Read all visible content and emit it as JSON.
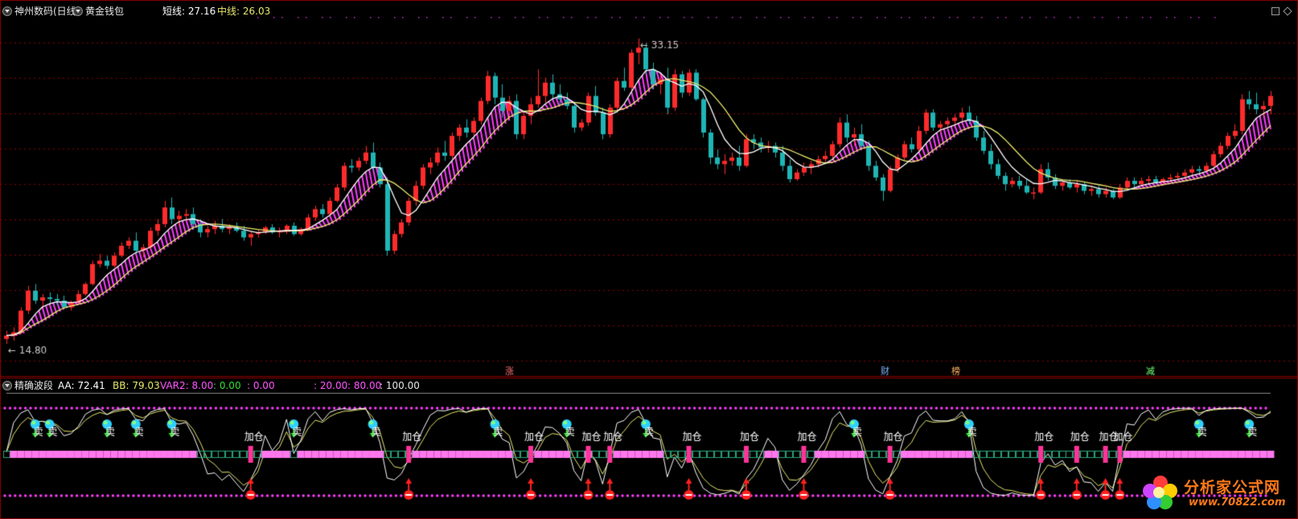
{
  "header": {
    "stock_name": "神州数码(日线)",
    "indicator_name": "黄金钱包",
    "short_label": "短线:",
    "short_value": "27.16",
    "mid_label": "中线:",
    "mid_value": "26.03"
  },
  "sub_header": {
    "indicator_name": "精确波段",
    "aa_label": "AA:",
    "aa_value": "72.41",
    "bb_label": "BB:",
    "bb_value": "79.03",
    "var2_label": "VAR2:",
    "var2_values": [
      "8.00",
      "0.00",
      "0.00",
      "20.00",
      "80.00",
      "100.00"
    ]
  },
  "logo": {
    "title": "分析家公式网",
    "url": "www.70822.com"
  },
  "colors": {
    "up": "#ff2b2b",
    "down": "#1fb5b5",
    "short_line": "#ffffff",
    "mid_line": "#e8e86a",
    "fill": "#ff3cff",
    "grid": "#8b0000",
    "dotted": "#ff3cff"
  },
  "chart_data": [
    {
      "type": "candlestick",
      "title": "黄金钱包",
      "price_range": [
        13.5,
        34.5
      ],
      "max_label": "33.15",
      "min_label": "14.80",
      "ohlc": [
        [
          15.1,
          15.6,
          14.8,
          15.3
        ],
        [
          15.3,
          15.8,
          15.0,
          15.5
        ],
        [
          15.5,
          17.0,
          15.4,
          16.8
        ],
        [
          16.8,
          18.3,
          16.6,
          18.0
        ],
        [
          18.0,
          18.4,
          17.2,
          17.4
        ],
        [
          17.4,
          17.8,
          17.0,
          17.6
        ],
        [
          17.6,
          17.9,
          17.2,
          17.5
        ],
        [
          17.5,
          17.8,
          17.1,
          17.4
        ],
        [
          17.4,
          17.7,
          16.9,
          17.0
        ],
        [
          17.0,
          17.4,
          16.8,
          17.3
        ],
        [
          17.3,
          18.0,
          17.2,
          17.8
        ],
        [
          17.8,
          18.5,
          17.7,
          18.4
        ],
        [
          18.4,
          19.8,
          18.3,
          19.6
        ],
        [
          19.6,
          20.2,
          19.4,
          19.8
        ],
        [
          19.8,
          20.1,
          19.3,
          19.5
        ],
        [
          19.5,
          20.3,
          19.4,
          20.1
        ],
        [
          20.1,
          20.9,
          20.0,
          20.7
        ],
        [
          20.7,
          21.2,
          20.5,
          21.0
        ],
        [
          21.0,
          21.5,
          20.2,
          20.4
        ],
        [
          20.4,
          20.8,
          20.0,
          20.6
        ],
        [
          20.6,
          21.8,
          20.5,
          21.6
        ],
        [
          21.6,
          22.3,
          21.3,
          22.0
        ],
        [
          22.0,
          23.4,
          21.8,
          23.0
        ],
        [
          23.0,
          23.6,
          22.0,
          22.3
        ],
        [
          22.3,
          22.8,
          21.9,
          22.5
        ],
        [
          22.5,
          22.9,
          22.2,
          22.6
        ],
        [
          22.6,
          23.0,
          21.7,
          22.0
        ],
        [
          22.0,
          22.3,
          21.2,
          21.5
        ],
        [
          21.5,
          21.9,
          21.2,
          21.7
        ],
        [
          21.7,
          22.2,
          21.4,
          21.9
        ],
        [
          21.9,
          22.3,
          21.5,
          21.7
        ],
        [
          21.7,
          22.0,
          21.4,
          21.8
        ],
        [
          21.8,
          22.1,
          21.5,
          21.6
        ],
        [
          21.6,
          21.9,
          21.0,
          21.2
        ],
        [
          21.2,
          21.6,
          20.7,
          21.4
        ],
        [
          21.4,
          21.7,
          21.2,
          21.5
        ],
        [
          21.5,
          21.9,
          21.4,
          21.8
        ],
        [
          21.8,
          22.0,
          21.4,
          21.5
        ],
        [
          21.5,
          21.8,
          21.2,
          21.6
        ],
        [
          21.6,
          22.0,
          21.4,
          21.9
        ],
        [
          21.9,
          22.1,
          21.3,
          21.4
        ],
        [
          21.4,
          21.8,
          21.3,
          21.7
        ],
        [
          21.7,
          22.6,
          21.6,
          22.4
        ],
        [
          22.4,
          23.1,
          22.2,
          22.9
        ],
        [
          22.9,
          23.2,
          22.4,
          22.6
        ],
        [
          22.6,
          23.6,
          22.5,
          23.4
        ],
        [
          23.4,
          24.4,
          23.3,
          24.2
        ],
        [
          24.2,
          25.7,
          24.0,
          25.5
        ],
        [
          25.5,
          25.9,
          25.1,
          25.4
        ],
        [
          25.4,
          26.0,
          25.2,
          25.8
        ],
        [
          25.8,
          26.7,
          25.6,
          26.3
        ],
        [
          26.3,
          26.9,
          25.2,
          25.4
        ],
        [
          25.4,
          25.7,
          24.2,
          24.4
        ],
        [
          24.4,
          24.8,
          20.1,
          20.4
        ],
        [
          20.4,
          21.6,
          20.2,
          21.4
        ],
        [
          21.4,
          22.3,
          21.2,
          22.1
        ],
        [
          22.1,
          23.6,
          21.9,
          23.4
        ],
        [
          23.4,
          24.6,
          23.1,
          24.3
        ],
        [
          24.3,
          25.6,
          24.1,
          25.4
        ],
        [
          25.4,
          26.0,
          25.0,
          25.7
        ],
        [
          25.7,
          26.6,
          25.5,
          26.3
        ],
        [
          26.3,
          27.0,
          25.8,
          26.1
        ],
        [
          26.1,
          27.5,
          25.9,
          27.3
        ],
        [
          27.3,
          28.0,
          27.0,
          27.8
        ],
        [
          27.8,
          28.3,
          27.2,
          27.5
        ],
        [
          27.5,
          28.4,
          27.3,
          28.2
        ],
        [
          28.2,
          29.6,
          28.0,
          29.4
        ],
        [
          29.4,
          31.2,
          29.2,
          30.9
        ],
        [
          30.9,
          31.1,
          29.2,
          29.6
        ],
        [
          29.6,
          30.4,
          28.4,
          28.8
        ],
        [
          28.8,
          29.7,
          28.3,
          29.4
        ],
        [
          29.4,
          29.8,
          27.1,
          27.4
        ],
        [
          27.4,
          28.8,
          27.1,
          28.5
        ],
        [
          28.5,
          29.6,
          28.0,
          29.2
        ],
        [
          29.2,
          31.3,
          29.0,
          29.7
        ],
        [
          29.7,
          30.8,
          29.3,
          30.5
        ],
        [
          30.5,
          31.0,
          29.5,
          29.8
        ],
        [
          29.8,
          30.4,
          29.2,
          29.5
        ],
        [
          29.5,
          29.9,
          28.9,
          29.1
        ],
        [
          29.1,
          29.3,
          27.5,
          27.8
        ],
        [
          27.8,
          28.3,
          27.6,
          28.1
        ],
        [
          28.1,
          29.9,
          27.9,
          29.7
        ],
        [
          29.7,
          30.3,
          28.5,
          28.7
        ],
        [
          28.7,
          29.0,
          27.1,
          27.4
        ],
        [
          27.4,
          29.2,
          27.2,
          29.0
        ],
        [
          29.0,
          30.8,
          28.8,
          30.6
        ],
        [
          30.6,
          31.4,
          30.0,
          30.2
        ],
        [
          30.2,
          32.5,
          30.0,
          32.3
        ],
        [
          32.3,
          33.15,
          31.6,
          32.6
        ],
        [
          32.6,
          32.9,
          31.0,
          31.3
        ],
        [
          31.3,
          31.7,
          30.1,
          30.4
        ],
        [
          30.4,
          31.0,
          29.8,
          30.7
        ],
        [
          30.7,
          31.4,
          28.6,
          29.0
        ],
        [
          29.0,
          31.3,
          28.8,
          31.0
        ],
        [
          31.0,
          31.2,
          29.6,
          29.9
        ],
        [
          29.9,
          31.3,
          29.7,
          31.1
        ],
        [
          31.1,
          31.3,
          29.4,
          29.5
        ],
        [
          29.5,
          29.6,
          27.2,
          27.5
        ],
        [
          27.5,
          27.7,
          25.6,
          26.0
        ],
        [
          26.0,
          26.5,
          25.3,
          25.6
        ],
        [
          25.6,
          26.2,
          25.0,
          25.8
        ],
        [
          25.8,
          26.3,
          25.5,
          26.0
        ],
        [
          26.0,
          26.7,
          25.2,
          25.5
        ],
        [
          25.5,
          27.4,
          25.4,
          27.1
        ],
        [
          27.1,
          27.4,
          26.5,
          26.9
        ],
        [
          26.9,
          27.2,
          26.3,
          26.6
        ],
        [
          26.6,
          27.0,
          26.3,
          26.7
        ],
        [
          26.7,
          26.9,
          26.0,
          26.3
        ],
        [
          26.3,
          26.7,
          25.2,
          25.5
        ],
        [
          25.5,
          25.9,
          24.5,
          24.7
        ],
        [
          24.7,
          25.3,
          24.6,
          25.1
        ],
        [
          25.1,
          25.7,
          24.9,
          25.4
        ],
        [
          25.4,
          25.8,
          25.0,
          25.6
        ],
        [
          25.6,
          26.1,
          25.4,
          25.9
        ],
        [
          25.9,
          26.4,
          25.6,
          26.1
        ],
        [
          26.1,
          27.0,
          25.9,
          26.8
        ],
        [
          26.8,
          28.4,
          26.6,
          28.1
        ],
        [
          28.1,
          28.6,
          26.9,
          27.2
        ],
        [
          27.2,
          27.8,
          26.7,
          27.4
        ],
        [
          27.4,
          28.0,
          26.5,
          26.7
        ],
        [
          26.7,
          27.0,
          25.2,
          25.5
        ],
        [
          25.5,
          25.8,
          24.6,
          24.8
        ],
        [
          24.8,
          25.0,
          23.4,
          24.0
        ],
        [
          24.0,
          25.5,
          23.9,
          25.3
        ],
        [
          25.3,
          26.2,
          25.1,
          26.0
        ],
        [
          26.0,
          27.0,
          25.8,
          26.8
        ],
        [
          26.8,
          27.2,
          26.3,
          26.5
        ],
        [
          26.5,
          27.9,
          26.3,
          27.6
        ],
        [
          27.6,
          28.9,
          27.4,
          28.7
        ],
        [
          28.7,
          28.9,
          27.6,
          27.8
        ],
        [
          27.8,
          28.2,
          27.5,
          28.0
        ],
        [
          28.0,
          28.4,
          27.7,
          28.2
        ],
        [
          28.2,
          28.6,
          27.9,
          28.4
        ],
        [
          28.4,
          29.0,
          28.1,
          28.7
        ],
        [
          28.7,
          29.1,
          28.0,
          28.2
        ],
        [
          28.2,
          28.5,
          27.0,
          27.2
        ],
        [
          27.2,
          27.6,
          26.2,
          26.4
        ],
        [
          26.4,
          26.8,
          25.3,
          25.6
        ],
        [
          25.6,
          25.9,
          24.7,
          24.9
        ],
        [
          24.9,
          25.1,
          24.0,
          24.4
        ],
        [
          24.4,
          24.8,
          24.2,
          24.6
        ],
        [
          24.6,
          24.9,
          24.1,
          24.3
        ],
        [
          24.3,
          24.7,
          23.8,
          23.9
        ],
        [
          23.9,
          24.2,
          23.5,
          23.9
        ],
        [
          23.9,
          25.6,
          23.8,
          25.3
        ],
        [
          25.3,
          25.7,
          24.6,
          24.8
        ],
        [
          24.8,
          25.0,
          24.1,
          24.3
        ],
        [
          24.3,
          24.6,
          24.0,
          24.5
        ],
        [
          24.5,
          24.7,
          24.1,
          24.2
        ],
        [
          24.2,
          24.6,
          23.9,
          24.4
        ],
        [
          24.4,
          24.5,
          23.8,
          24.0
        ],
        [
          24.0,
          24.3,
          23.7,
          24.1
        ],
        [
          24.1,
          24.3,
          23.6,
          23.8
        ],
        [
          23.8,
          24.2,
          23.6,
          24.0
        ],
        [
          24.0,
          24.1,
          23.5,
          23.6
        ],
        [
          23.6,
          24.4,
          23.5,
          24.2
        ],
        [
          24.2,
          24.8,
          24.1,
          24.6
        ],
        [
          24.6,
          24.8,
          24.2,
          24.4
        ],
        [
          24.4,
          24.8,
          24.3,
          24.6
        ],
        [
          24.6,
          24.9,
          24.4,
          24.7
        ],
        [
          24.7,
          24.9,
          24.4,
          24.5
        ],
        [
          24.5,
          24.8,
          24.3,
          24.7
        ],
        [
          24.7,
          25.0,
          24.5,
          24.8
        ],
        [
          24.8,
          25.1,
          24.6,
          24.9
        ],
        [
          24.9,
          25.3,
          24.7,
          25.1
        ],
        [
          25.1,
          25.5,
          24.9,
          25.3
        ],
        [
          25.3,
          25.5,
          25.0,
          25.2
        ],
        [
          25.2,
          25.7,
          25.1,
          25.5
        ],
        [
          25.5,
          26.4,
          25.4,
          26.2
        ],
        [
          26.2,
          26.9,
          26.0,
          26.7
        ],
        [
          26.7,
          27.5,
          26.5,
          27.3
        ],
        [
          27.3,
          28.0,
          27.1,
          27.6
        ],
        [
          27.6,
          29.8,
          27.4,
          29.5
        ],
        [
          29.5,
          30.0,
          28.9,
          29.2
        ],
        [
          29.2,
          29.9,
          28.6,
          28.9
        ],
        [
          28.9,
          29.4,
          28.5,
          29.1
        ],
        [
          29.1,
          30.0,
          28.6,
          29.7
        ]
      ],
      "short_line_last": 27.16,
      "mid_line_last": 26.03,
      "event_markers": [
        "涨",
        "财",
        "榜",
        "减"
      ]
    },
    {
      "type": "line",
      "title": "精确波段",
      "series": [
        {
          "name": "AA",
          "last": 72.41
        },
        {
          "name": "BB",
          "last": 79.03
        }
      ],
      "levels": [
        0,
        20,
        80,
        100
      ],
      "annotations": [
        "加仓",
        "卖"
      ]
    }
  ]
}
